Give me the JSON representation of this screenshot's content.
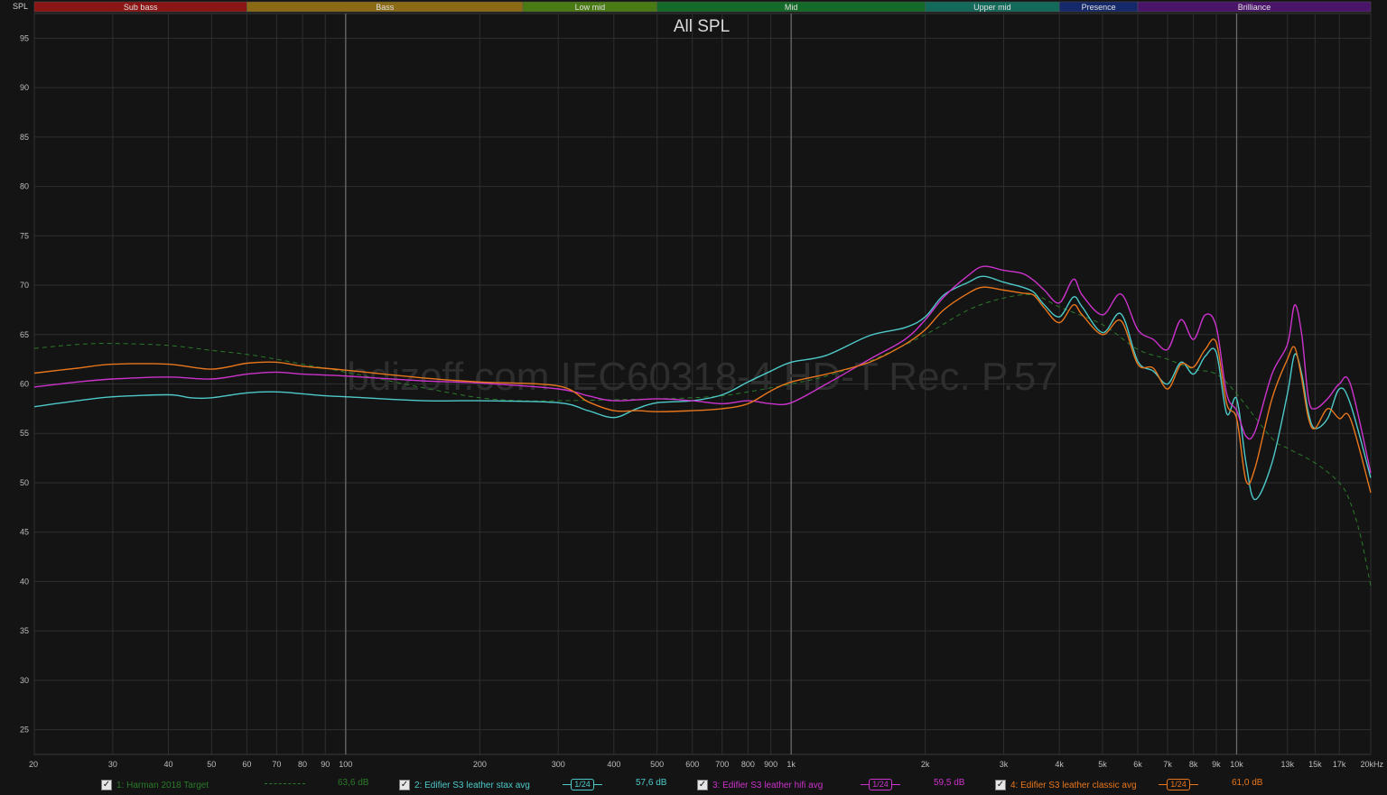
{
  "chart_data": {
    "type": "line",
    "title": "All SPL",
    "watermark": "bdizoff.com IEC60318-4 HD-T Rec. P.57",
    "ylabel": "SPL",
    "x_scale": "log",
    "xlim": [
      20,
      20000
    ],
    "ylim": [
      22.5,
      97.5
    ],
    "yticks": [
      25,
      30,
      35,
      40,
      45,
      50,
      55,
      60,
      65,
      70,
      75,
      80,
      85,
      90,
      95
    ],
    "xticks": [
      {
        "v": 20,
        "label": "20"
      },
      {
        "v": 30,
        "label": "30"
      },
      {
        "v": 40,
        "label": "40"
      },
      {
        "v": 50,
        "label": "50"
      },
      {
        "v": 60,
        "label": "60"
      },
      {
        "v": 70,
        "label": "70"
      },
      {
        "v": 80,
        "label": "80"
      },
      {
        "v": 90,
        "label": "90"
      },
      {
        "v": 100,
        "label": "100"
      },
      {
        "v": 200,
        "label": "200"
      },
      {
        "v": 300,
        "label": "300"
      },
      {
        "v": 400,
        "label": "400"
      },
      {
        "v": 500,
        "label": "500"
      },
      {
        "v": 600,
        "label": "600"
      },
      {
        "v": 700,
        "label": "700"
      },
      {
        "v": 800,
        "label": "800"
      },
      {
        "v": 900,
        "label": "900"
      },
      {
        "v": 1000,
        "label": "1k"
      },
      {
        "v": 2000,
        "label": "2k"
      },
      {
        "v": 3000,
        "label": "3k"
      },
      {
        "v": 4000,
        "label": "4k"
      },
      {
        "v": 5000,
        "label": "5k"
      },
      {
        "v": 6000,
        "label": "6k"
      },
      {
        "v": 7000,
        "label": "7k"
      },
      {
        "v": 8000,
        "label": "8k"
      },
      {
        "v": 9000,
        "label": "9k"
      },
      {
        "v": 10000,
        "label": "10k"
      },
      {
        "v": 13000,
        "label": "13k"
      },
      {
        "v": 15000,
        "label": "15k"
      },
      {
        "v": 17000,
        "label": "17k"
      },
      {
        "v": 20000,
        "label": "20kHz"
      }
    ],
    "bands": [
      {
        "name": "Sub bass",
        "from": 20,
        "to": 60,
        "color": "#8b1414"
      },
      {
        "name": "Bass",
        "from": 60,
        "to": 250,
        "color": "#8a6a14"
      },
      {
        "name": "Low mid",
        "from": 250,
        "to": 500,
        "color": "#4a7a14"
      },
      {
        "name": "Mid",
        "from": 500,
        "to": 2000,
        "color": "#146a28"
      },
      {
        "name": "Upper mid",
        "from": 2000,
        "to": 4000,
        "color": "#146a5a"
      },
      {
        "name": "Presence",
        "from": 4000,
        "to": 6000,
        "color": "#14286a"
      },
      {
        "name": "Brilliance",
        "from": 6000,
        "to": 20000,
        "color": "#4a146a"
      }
    ],
    "series": [
      {
        "name": "1: Harman 2018 Target",
        "color": "#2a7a2a",
        "dashed": true,
        "level": "63,6 dB",
        "smoothing": "",
        "x": [
          20,
          25,
          30,
          40,
          50,
          60,
          70,
          80,
          100,
          150,
          200,
          250,
          300,
          400,
          500,
          600,
          700,
          800,
          1000,
          1200,
          1500,
          2000,
          2500,
          3000,
          3500,
          4000,
          5000,
          6000,
          7000,
          8000,
          9000,
          10000,
          12000,
          13000,
          15000,
          17000,
          18000,
          19000,
          20000
        ],
        "y": [
          63.6,
          64.0,
          64.1,
          63.9,
          63.4,
          63.0,
          62.5,
          62.0,
          61.2,
          59.6,
          58.6,
          58.3,
          58.3,
          58.4,
          58.5,
          58.6,
          58.8,
          59.2,
          60.0,
          60.8,
          62.3,
          65.0,
          67.5,
          68.7,
          69.0,
          67.8,
          66.0,
          63.5,
          62.5,
          61.5,
          61.0,
          59.0,
          54.5,
          53.5,
          52.0,
          50.0,
          48.0,
          44.5,
          39.5
        ]
      },
      {
        "name": "2: Edifier S3 leather stax avg",
        "color": "#4ec9c9",
        "dashed": false,
        "level": "57,6 dB",
        "smoothing": "1/24",
        "x": [
          20,
          25,
          30,
          40,
          45,
          50,
          60,
          70,
          80,
          90,
          100,
          150,
          200,
          300,
          350,
          400,
          450,
          500,
          600,
          700,
          800,
          900,
          1000,
          1200,
          1500,
          1800,
          2000,
          2200,
          2500,
          2700,
          3000,
          3300,
          3500,
          3700,
          4000,
          4300,
          4500,
          5000,
          5500,
          6000,
          6500,
          7000,
          7500,
          8000,
          8500,
          9000,
          9500,
          10000,
          10500,
          11000,
          12000,
          13000,
          13500,
          14000,
          14500,
          15000,
          16000,
          17000,
          18000,
          20000
        ],
        "y": [
          57.7,
          58.3,
          58.7,
          58.9,
          58.6,
          58.6,
          59.1,
          59.2,
          59.0,
          58.8,
          58.7,
          58.3,
          58.3,
          58.1,
          57.3,
          56.6,
          57.5,
          58.1,
          58.3,
          58.9,
          60.2,
          61.3,
          62.2,
          62.9,
          64.9,
          65.7,
          66.8,
          69.0,
          70.3,
          70.9,
          70.3,
          69.8,
          69.3,
          68.0,
          66.8,
          68.8,
          67.8,
          65.2,
          67.1,
          62.3,
          61.3,
          60.0,
          62.2,
          61.0,
          62.8,
          63.2,
          57.0,
          58.5,
          52.0,
          48.3,
          52.0,
          59.0,
          63.0,
          61.0,
          57.0,
          55.5,
          56.5,
          59.5,
          58.0,
          50.5
        ]
      },
      {
        "name": "3: Edifier S3 leather hifi avg",
        "color": "#cc33cc",
        "dashed": false,
        "level": "59,5 dB",
        "smoothing": "1/24",
        "x": [
          20,
          25,
          30,
          40,
          50,
          60,
          70,
          80,
          100,
          150,
          200,
          300,
          350,
          400,
          500,
          600,
          700,
          800,
          900,
          1000,
          1200,
          1500,
          1800,
          2000,
          2200,
          2500,
          2700,
          3000,
          3300,
          3500,
          3700,
          4000,
          4300,
          4500,
          5000,
          5500,
          6000,
          6500,
          7000,
          7500,
          8000,
          8500,
          9000,
          9500,
          10000,
          10500,
          11000,
          12000,
          13000,
          13500,
          14000,
          14500,
          15000,
          16000,
          17000,
          18000,
          20000
        ],
        "y": [
          59.7,
          60.2,
          60.5,
          60.7,
          60.5,
          61.0,
          61.2,
          61.0,
          60.8,
          60.3,
          60.1,
          59.5,
          58.8,
          58.3,
          58.5,
          58.3,
          58.0,
          58.3,
          58.0,
          58.1,
          60.0,
          62.5,
          64.5,
          66.5,
          68.8,
          71.0,
          71.9,
          71.5,
          71.2,
          70.5,
          69.5,
          68.2,
          70.6,
          69.0,
          67.0,
          69.1,
          65.5,
          64.5,
          63.5,
          66.5,
          64.5,
          67.0,
          65.8,
          59.0,
          57.3,
          54.7,
          55.2,
          61.0,
          64.0,
          68.0,
          65.0,
          58.5,
          57.5,
          58.5,
          60.0,
          60.0,
          51.0
        ]
      },
      {
        "name": "4: Edifier S3 leather classic avg",
        "color": "#e8761c",
        "dashed": false,
        "level": "61,0 dB",
        "smoothing": "1/24",
        "x": [
          20,
          25,
          30,
          40,
          50,
          60,
          70,
          80,
          100,
          150,
          200,
          300,
          350,
          400,
          450,
          500,
          600,
          700,
          800,
          900,
          1000,
          1200,
          1500,
          1800,
          2000,
          2200,
          2500,
          2700,
          3000,
          3300,
          3500,
          3700,
          4000,
          4300,
          4500,
          5000,
          5500,
          6000,
          6500,
          7000,
          7500,
          8000,
          8500,
          9000,
          9500,
          10000,
          10500,
          11000,
          12000,
          13000,
          13500,
          14000,
          14500,
          15000,
          16000,
          17000,
          18000,
          20000
        ],
        "y": [
          61.1,
          61.6,
          62.0,
          62.0,
          61.5,
          62.1,
          62.2,
          61.8,
          61.4,
          60.6,
          60.2,
          59.8,
          58.2,
          57.3,
          57.3,
          57.2,
          57.3,
          57.5,
          58.0,
          59.3,
          60.2,
          61.0,
          62.2,
          64.0,
          65.5,
          67.5,
          69.2,
          69.8,
          69.5,
          69.2,
          69.0,
          67.7,
          66.2,
          68.0,
          67.0,
          65.0,
          66.4,
          62.0,
          61.6,
          59.5,
          62.0,
          61.7,
          63.5,
          64.2,
          58.0,
          56.5,
          50.2,
          51.5,
          58.5,
          62.5,
          63.7,
          60.5,
          56.5,
          55.5,
          57.5,
          56.5,
          56.5,
          49.0
        ]
      }
    ]
  },
  "legend": {
    "items": [
      {
        "label": "1: Harman 2018 Target",
        "smoothing": "",
        "level": "63,6 dB"
      },
      {
        "label": "2: Edifier S3 leather stax avg",
        "smoothing": "1/24",
        "level": "57,6 dB"
      },
      {
        "label": "3: Edifier S3 leather hifi avg",
        "smoothing": "1/24",
        "level": "59,5 dB"
      },
      {
        "label": "4: Edifier S3 leather classic avg",
        "smoothing": "1/24",
        "level": "61,0 dB"
      }
    ],
    "check_glyph": "✓"
  }
}
